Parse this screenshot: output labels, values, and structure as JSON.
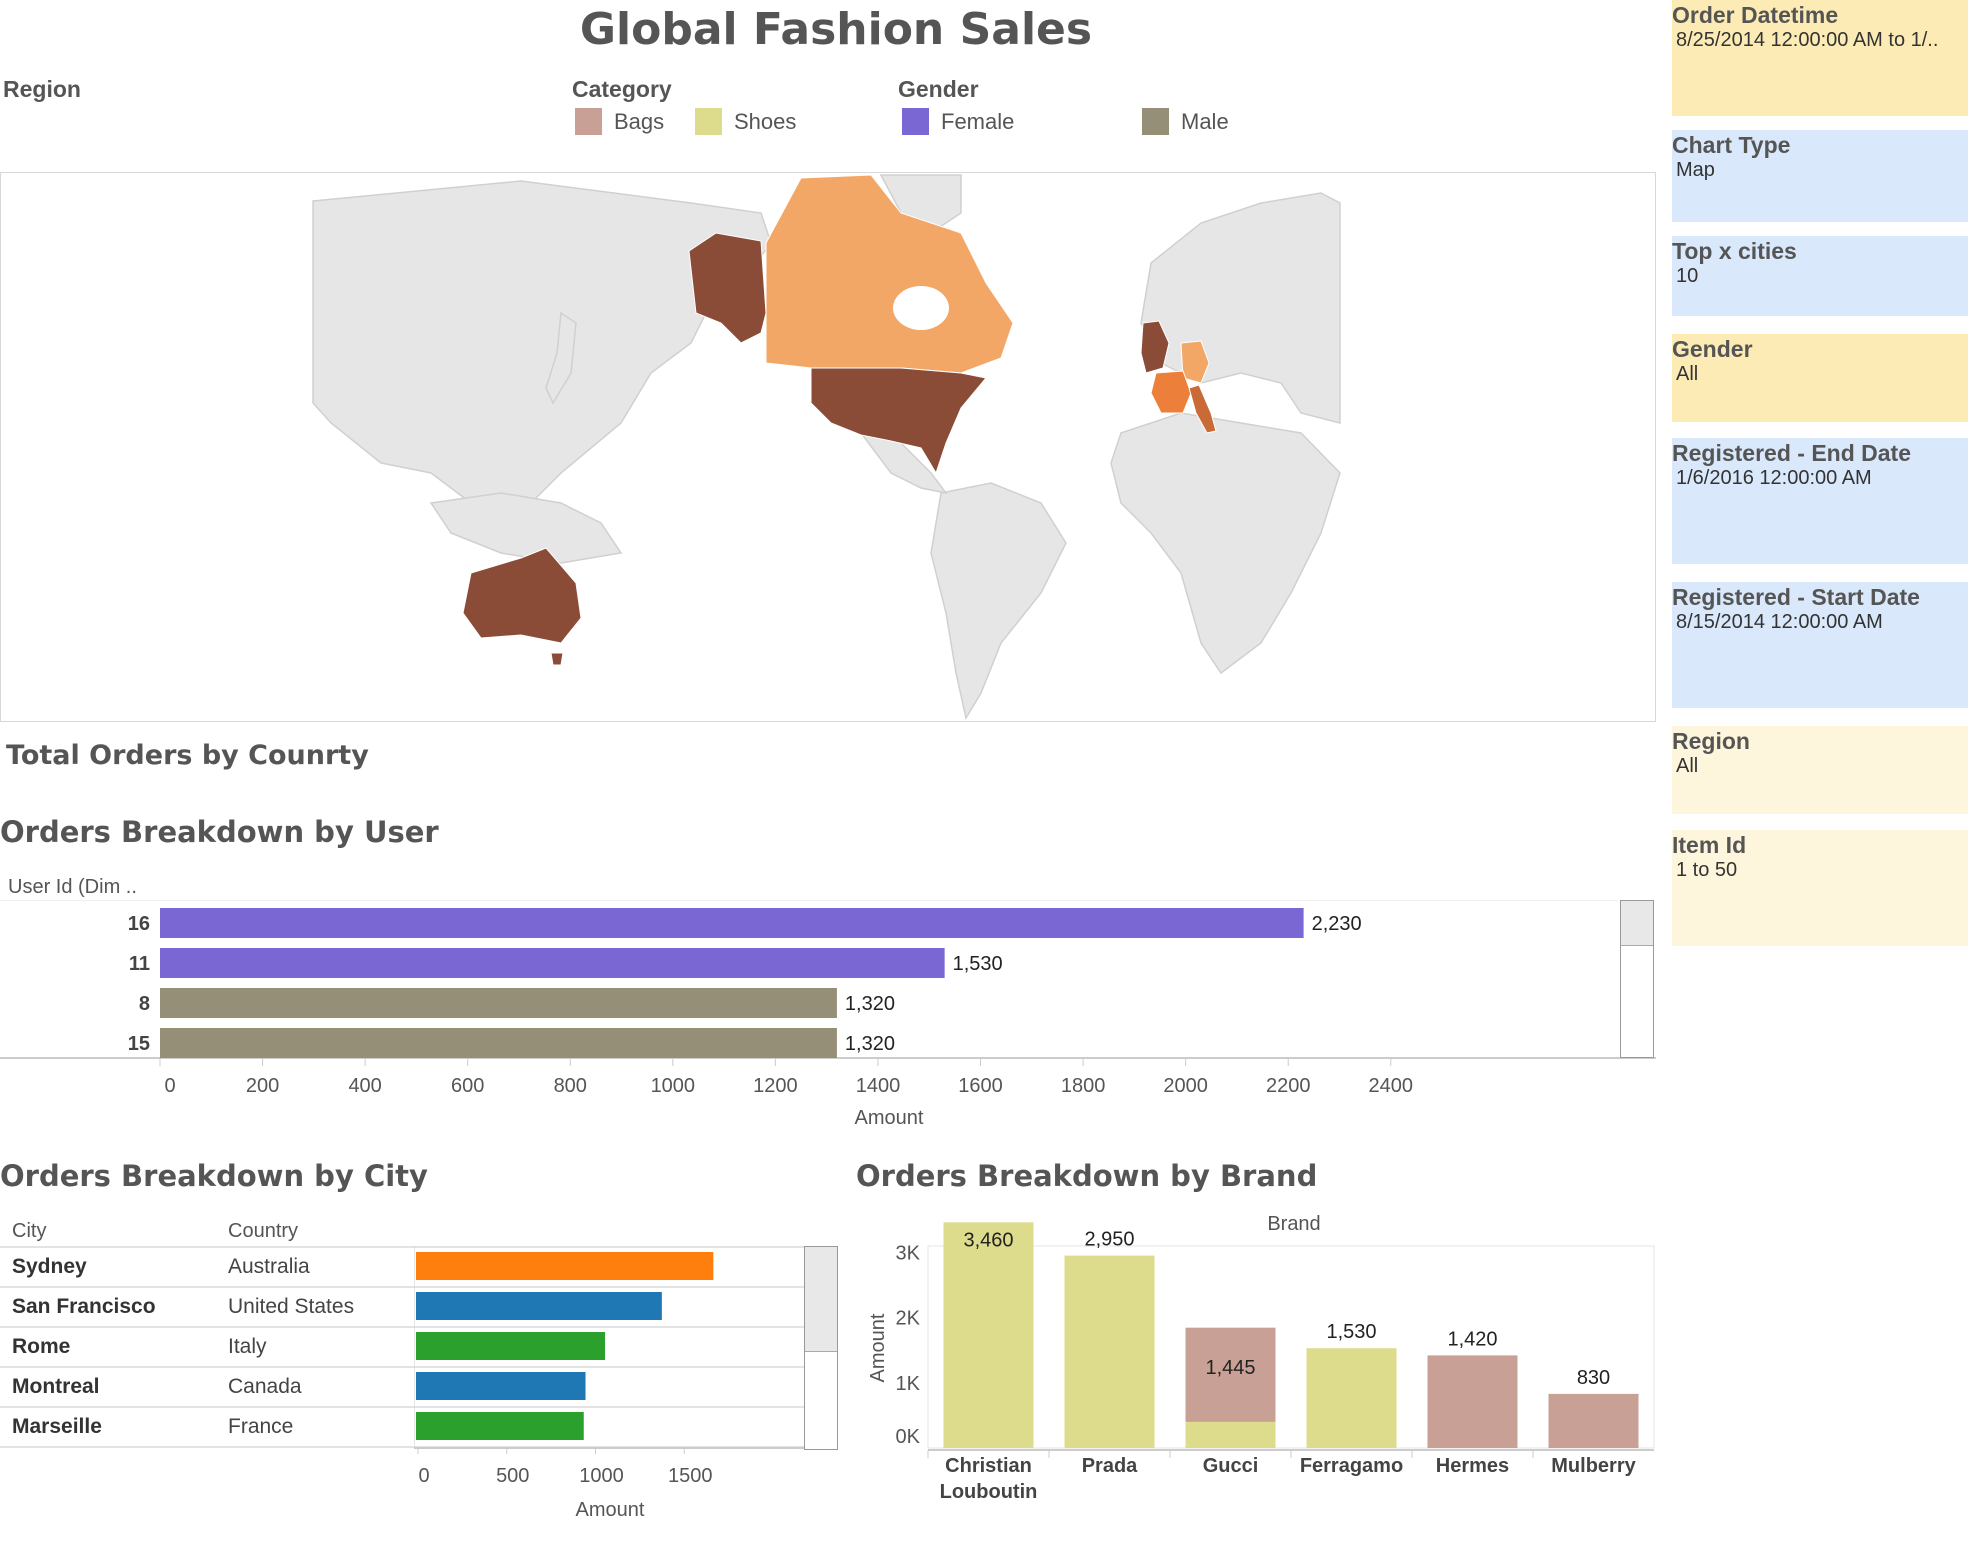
{
  "title": "Global Fashion Sales",
  "legends": {
    "region_label": "Region",
    "category": {
      "title": "Category",
      "items": [
        {
          "label": "Bags",
          "color": "#c9a095"
        },
        {
          "label": "Shoes",
          "color": "#dcdc8c"
        }
      ]
    },
    "gender": {
      "title": "Gender",
      "items": [
        {
          "label": "Female",
          "color": "#7b67d4"
        },
        {
          "label": "Male",
          "color": "#968f78"
        }
      ]
    }
  },
  "map": {
    "highlighted_countries": [
      {
        "name": "United States",
        "color": "#8b4c37"
      },
      {
        "name": "Canada",
        "color": "#f3a766"
      },
      {
        "name": "Australia",
        "color": "#8b4c37"
      },
      {
        "name": "United Kingdom",
        "color": "#8b4c37"
      },
      {
        "name": "France",
        "color": "#ec7f3a"
      },
      {
        "name": "Italy",
        "color": "#c96a37"
      },
      {
        "name": "Germany",
        "color": "#f3a766"
      }
    ],
    "base_color": "#e6e6e6"
  },
  "sections": {
    "total_orders": "Total Orders by Counrty",
    "by_user": "Orders Breakdown by User",
    "by_city": "Orders Breakdown by City",
    "by_brand": "Orders Breakdown by Brand"
  },
  "user_chart": {
    "header": "User Id (Dim ..",
    "chart_data": {
      "type": "bar",
      "orientation": "horizontal",
      "categories": [
        "16",
        "11",
        "8",
        "15"
      ],
      "values": [
        2230,
        1530,
        1320,
        1320
      ],
      "value_labels": [
        "2,230",
        "1,530",
        "1,320",
        "1,320"
      ],
      "colors": [
        "#7b67d4",
        "#7b67d4",
        "#968f78",
        "#968f78"
      ],
      "xlabel": "Amount",
      "xlim": [
        0,
        2500
      ],
      "ticks": [
        0,
        200,
        400,
        600,
        800,
        1000,
        1200,
        1400,
        1600,
        1800,
        2000,
        2200,
        2400
      ]
    }
  },
  "city_chart": {
    "headers": {
      "city": "City",
      "country": "Country"
    },
    "rows": [
      {
        "city": "Sydney",
        "country": "Australia",
        "value": 1630,
        "color": "#ff7f0e"
      },
      {
        "city": "San Francisco",
        "country": "United States",
        "value": 1340,
        "color": "#1f77b4"
      },
      {
        "city": "Rome",
        "country": "Italy",
        "value": 1020,
        "color": "#2ca02c"
      },
      {
        "city": "Montreal",
        "country": "Canada",
        "value": 910,
        "color": "#1f77b4"
      },
      {
        "city": "Marseille",
        "country": "France",
        "value": 900,
        "color": "#2ca02c"
      }
    ],
    "chart_data": {
      "type": "bar",
      "orientation": "horizontal",
      "categories": [
        "Sydney",
        "San Francisco",
        "Rome",
        "Montreal",
        "Marseille"
      ],
      "values": [
        1630,
        1340,
        1020,
        910,
        900
      ],
      "xlabel": "Amount",
      "xlim": [
        0,
        1800
      ],
      "ticks": [
        0,
        500,
        1000,
        1500
      ]
    }
  },
  "brand_chart": {
    "header": "Brand",
    "chart_data": {
      "type": "bar",
      "stacked": true,
      "categories": [
        "Christian\nLouboutin",
        "Prada",
        "Gucci",
        "Ferragamo",
        "Hermes",
        "Mulberry"
      ],
      "category_lines": [
        [
          "Christian",
          "Louboutin"
        ],
        [
          "Prada"
        ],
        [
          "Gucci"
        ],
        [
          "Ferragamo"
        ],
        [
          "Hermes"
        ],
        [
          "Mulberry"
        ]
      ],
      "series": [
        {
          "name": "Shoes",
          "color": "#dcdc8c",
          "values": [
            3460,
            2950,
            400,
            1530,
            0,
            0
          ]
        },
        {
          "name": "Bags",
          "color": "#c9a095",
          "values": [
            0,
            0,
            1445,
            0,
            1420,
            830
          ]
        }
      ],
      "totals": [
        3460,
        2950,
        1845,
        1530,
        1420,
        830
      ],
      "value_labels": [
        "3,460",
        "2,950",
        "1,445",
        "1,530",
        "1,420",
        "830"
      ],
      "ylabel": "Amount",
      "ylim": [
        0,
        3500
      ],
      "yticks": [
        {
          "v": 0,
          "label": "0K"
        },
        {
          "v": 1000,
          "label": "1K"
        },
        {
          "v": 2000,
          "label": "2K"
        },
        {
          "v": 3000,
          "label": "3K"
        }
      ]
    }
  },
  "filters": [
    {
      "title": "Order Datetime",
      "value": "8/25/2014 12:00:00 AM to 1/..",
      "color": "#fdebb5"
    },
    {
      "title": "Chart Type",
      "value": "Map",
      "color": "#d9e8fb"
    },
    {
      "title": "Top x cities",
      "value": "10",
      "color": "#d9e8fb"
    },
    {
      "title": "Gender",
      "value": "All",
      "color": "#fdebb5"
    },
    {
      "title": "Registered - End Date",
      "value": "1/6/2016 12:00:00 AM",
      "color": "#d9e8fb"
    },
    {
      "title": "Registered - Start Date",
      "value": "8/15/2014 12:00:00 AM",
      "color": "#d9e8fb"
    },
    {
      "title": "Region",
      "value": "All",
      "color": "#fef6dc"
    },
    {
      "title": "Item Id",
      "value": "1 to 50",
      "color": "#fef6dc"
    }
  ]
}
